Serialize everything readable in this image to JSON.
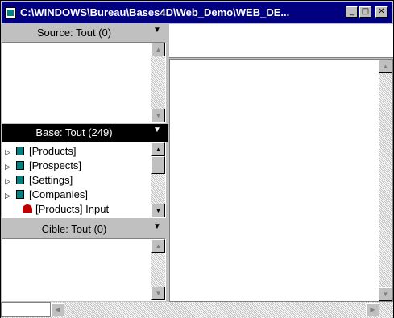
{
  "window": {
    "title": "C:\\WINDOWS\\Bureau\\Bases4D\\Web_Demo\\WEB_DE...",
    "min_label": "_",
    "max_label": "□",
    "close_label": "✕"
  },
  "source": {
    "label": "Source: Tout (0)"
  },
  "base": {
    "label": "Base: Tout (249)",
    "items": [
      {
        "label": "[Products]"
      },
      {
        "label": "[Prospects]"
      },
      {
        "label": "[Settings]"
      },
      {
        "label": "[Companies]"
      },
      {
        "label": "[Products] Input"
      }
    ]
  },
  "cible": {
    "label": "Cible: Tout (0)"
  },
  "icons": {
    "dropdown": "▼",
    "expand": "▷",
    "scroll_up": "▲",
    "scroll_down": "▼",
    "scroll_left": "◀",
    "scroll_right": "▶"
  }
}
